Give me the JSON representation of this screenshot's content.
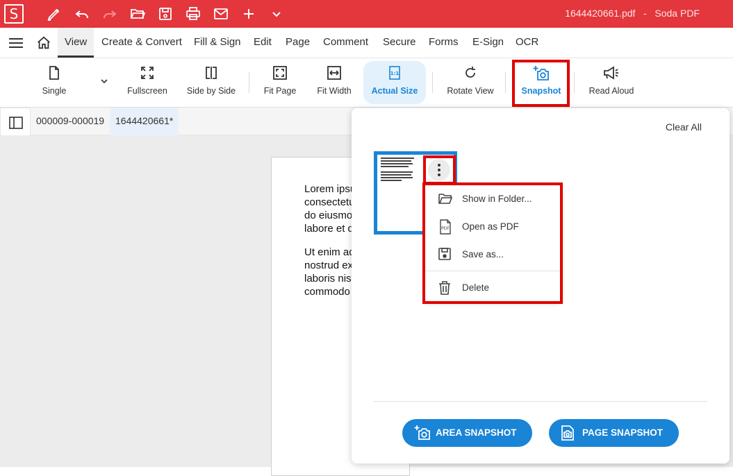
{
  "titlebar": {
    "logo": "S",
    "title": "1644420661.pdf   -   Soda PDF",
    "quick_icons": [
      "pen-icon",
      "undo-icon",
      "redo-icon",
      "open-folder-icon",
      "save-icon",
      "print-icon",
      "mail-icon",
      "plus-icon",
      "chevron-down-icon"
    ]
  },
  "menu": {
    "items": [
      "View",
      "Create & Convert",
      "Fill & Sign",
      "Edit",
      "Page",
      "Comment",
      "Secure",
      "Forms",
      "E-Sign",
      "OCR"
    ],
    "active": "View"
  },
  "toolbar": {
    "single": "Single",
    "fullscreen": "Fullscreen",
    "side_by_side": "Side by Side",
    "fit_page": "Fit Page",
    "fit_width": "Fit Width",
    "actual_size": "Actual Size",
    "rotate_view": "Rotate View",
    "snapshot": "Snapshot",
    "read_aloud": "Read Aloud"
  },
  "tabs": [
    "000009-000019",
    "1644420661*"
  ],
  "document": {
    "para1": [
      "Lorem ipsum",
      "consectetur",
      "do eiusmod",
      "labore et d"
    ],
    "para2": [
      "Ut enim ad",
      "nostrud exe",
      "laboris nisi",
      "commodo"
    ]
  },
  "snapshot_panel": {
    "clear_all": "Clear All",
    "context_menu": {
      "show_in_folder": "Show in Folder...",
      "open_as_pdf": "Open as PDF",
      "save_as": "Save as...",
      "delete": "Delete",
      "pdf_icon_text": "PDF"
    },
    "area_snapshot": "AREA SNAPSHOT",
    "page_snapshot": "PAGE SNAPSHOT"
  },
  "colors": {
    "brand_red": "#e3363d",
    "accent_blue": "#1a84d6",
    "highlight_red": "#e00000"
  }
}
